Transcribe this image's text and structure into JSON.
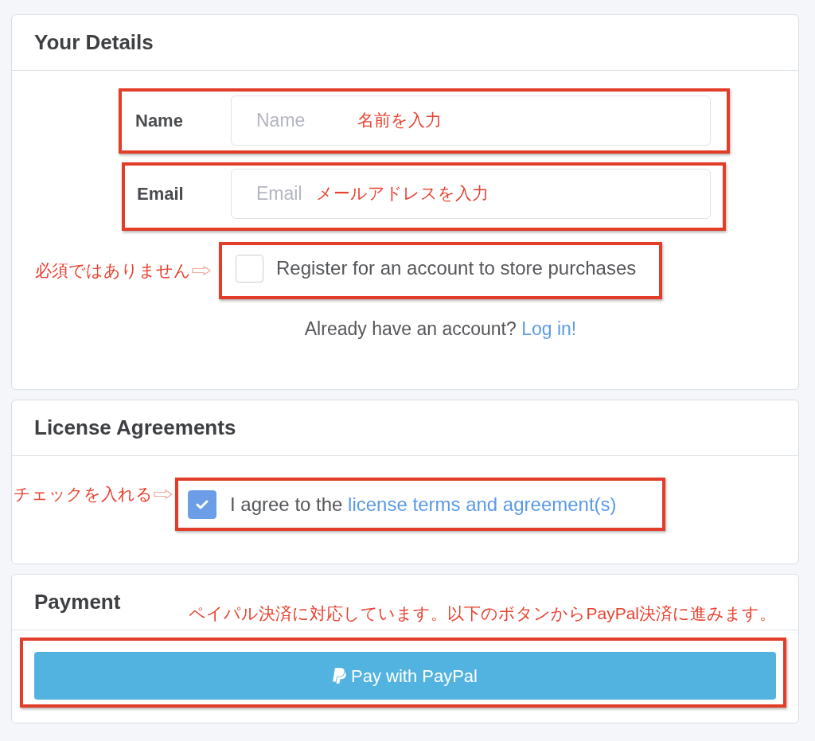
{
  "details": {
    "title": "Your Details",
    "fields": [
      {
        "label": "Name",
        "placeholder": "Name",
        "note": "名前を入力",
        "highlighted": true
      },
      {
        "label": "Email",
        "placeholder": "Email",
        "note": "メールアドレスを入力",
        "highlighted": true
      }
    ],
    "register": {
      "label": "Register for an account to store purchases",
      "checked": false,
      "note": "必須ではありません",
      "highlighted": true
    },
    "login_prompt": {
      "text": "Already have an account?",
      "link": "Log in!"
    }
  },
  "license": {
    "title": "License Agreements",
    "agree": {
      "text": "I agree to the",
      "link": "license terms and agreement(s)",
      "checked": true,
      "note": "チェックを入れる",
      "highlighted": true
    }
  },
  "payment": {
    "title": "Payment",
    "note": "ペイパル決済に対応しています。以下のボタンからPayPal決済に進みます。",
    "button": {
      "label": "Pay with PayPal",
      "highlighted": true
    }
  }
}
